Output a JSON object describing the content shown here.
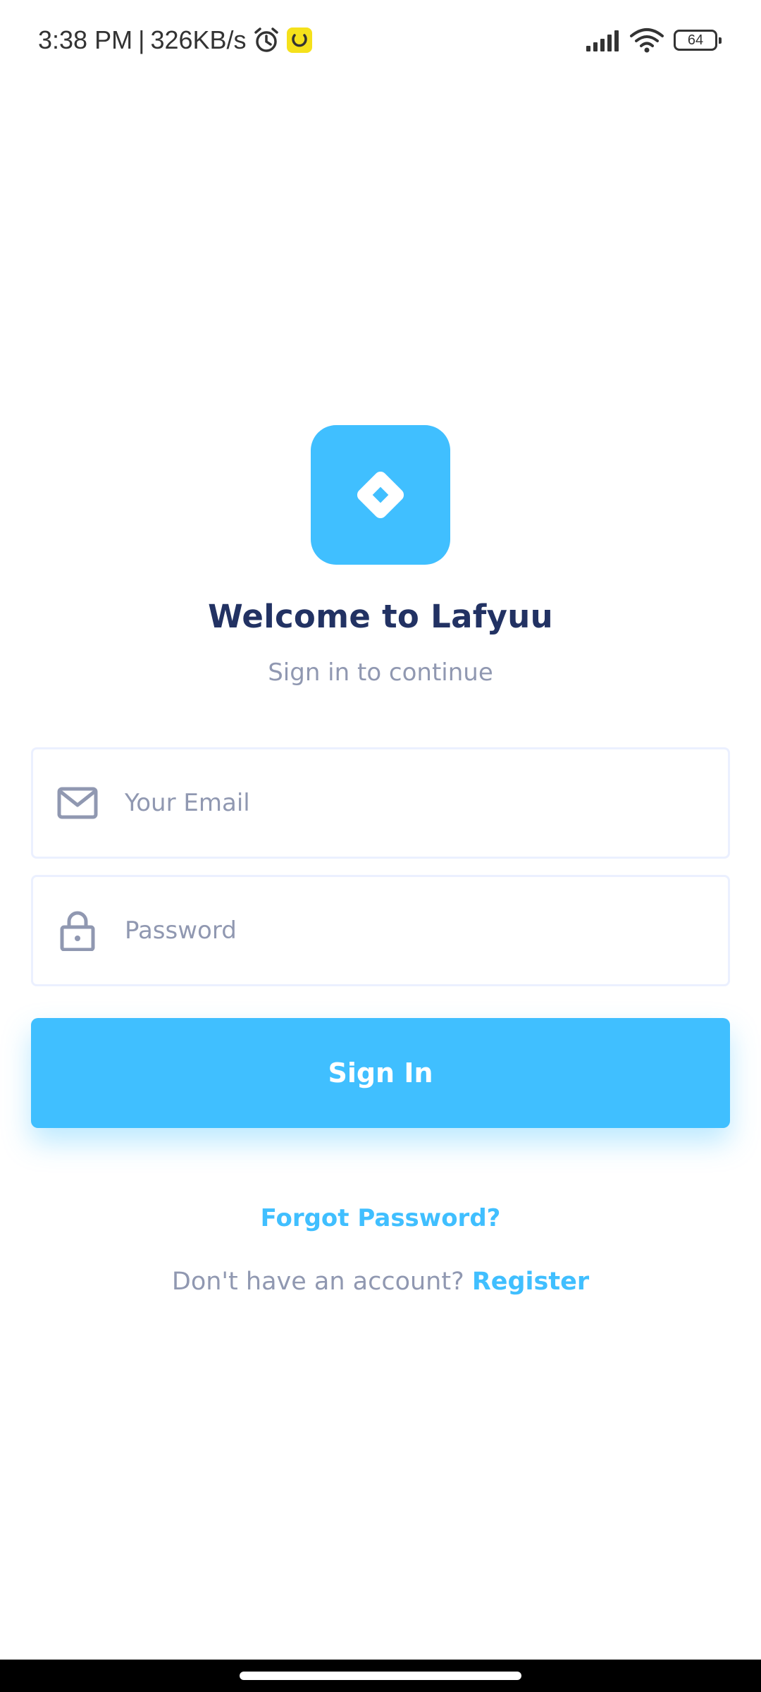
{
  "status_bar": {
    "time": "3:38 PM",
    "separator": "|",
    "network_speed": "326KB/s",
    "battery_level": "64",
    "icons": [
      "alarm-icon",
      "app-notification-icon",
      "signal-icon",
      "wifi-icon",
      "battery-icon"
    ]
  },
  "logo": {
    "icon": "diamond-logo-icon",
    "color": "#40BFFF"
  },
  "header": {
    "title": "Welcome to Lafyuu",
    "subtitle": "Sign in to continue"
  },
  "form": {
    "email": {
      "placeholder": "Your Email",
      "value": "",
      "icon": "mail-icon"
    },
    "password": {
      "placeholder": "Password",
      "value": "",
      "icon": "lock-icon"
    },
    "submit_label": "Sign In"
  },
  "links": {
    "forgot_password": "Forgot Password?",
    "no_account_text": "Don't have an account?",
    "register_label": "Register"
  },
  "colors": {
    "accent": "#40BFFF",
    "title": "#223263",
    "muted": "#9098B1",
    "border": "#EBF0FF"
  }
}
